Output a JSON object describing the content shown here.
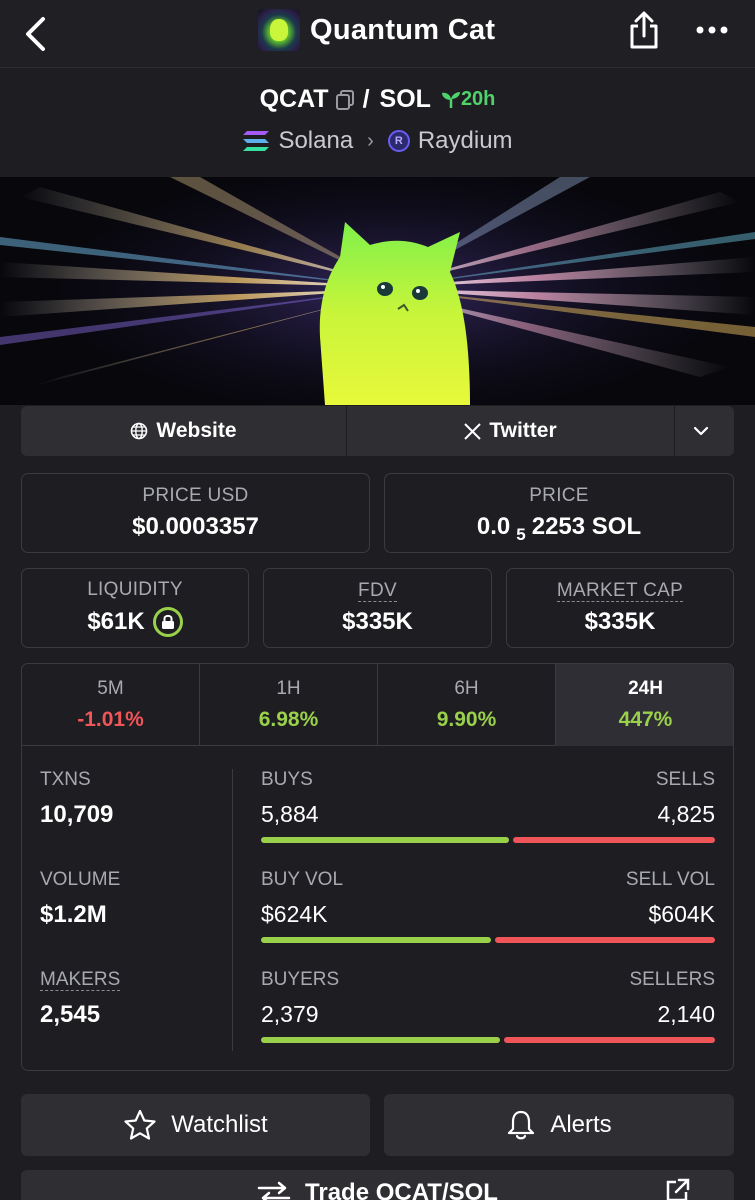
{
  "header": {
    "title": "Quantum Cat",
    "icons": {
      "back": "chevron-left-icon",
      "share": "share-icon",
      "more": "more-dots-icon"
    }
  },
  "pair": {
    "base": "QCAT",
    "separator": "/",
    "quote": "SOL",
    "age": "20h",
    "chain": "Solana",
    "dex": "Raydium",
    "dex_icon_letter": "R"
  },
  "links": {
    "website": "Website",
    "twitter": "Twitter"
  },
  "price": {
    "usd_label": "PRICE USD",
    "usd_value": "$0.0003357",
    "native_label": "PRICE",
    "native_prefix": "0.0",
    "native_zeros": "5",
    "native_digits": "2253 SOL"
  },
  "metrics": {
    "liquidity_label": "LIQUIDITY",
    "liquidity_value": "$61K",
    "fdv_label": "FDV",
    "fdv_value": "$335K",
    "mcap_label": "MARKET CAP",
    "mcap_value": "$335K"
  },
  "timeframes": [
    {
      "label": "5M",
      "value": "-1.01%"
    },
    {
      "label": "1H",
      "value": "6.98%"
    },
    {
      "label": "6H",
      "value": "9.90%"
    },
    {
      "label": "24H",
      "value": "447%"
    }
  ],
  "stats": {
    "txns_label": "TXNS",
    "txns_value": "10,709",
    "volume_label": "VOLUME",
    "volume_value": "$1.2M",
    "makers_label": "MAKERS",
    "makers_value": "2,545",
    "buys_label": "BUYS",
    "buys_value": "5,884",
    "buys_fraction": 0.55,
    "sells_label": "SELLS",
    "sells_value": "4,825",
    "buyvol_label": "BUY VOL",
    "buyvol_value": "$624K",
    "buyvol_fraction": 0.51,
    "sellvol_label": "SELL VOL",
    "sellvol_value": "$604K",
    "buyers_label": "BUYERS",
    "buyers_value": "2,379",
    "buyers_fraction": 0.53,
    "sellers_label": "SELLERS",
    "sellers_value": "2,140"
  },
  "actions": {
    "watchlist": "Watchlist",
    "alerts": "Alerts",
    "trade": "Trade QCAT/SOL"
  },
  "colors": {
    "background": "#1d1d22",
    "positive": "#9ad14a",
    "negative": "#f0555a",
    "age_green": "#4fd16b"
  }
}
